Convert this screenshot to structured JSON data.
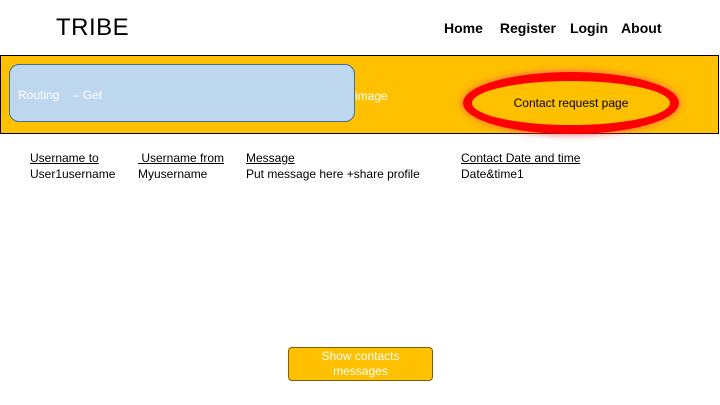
{
  "header": {
    "logo": "TRIBE",
    "nav": [
      "Home",
      "Register",
      "Login",
      "About"
    ]
  },
  "banner": {
    "routing_label": "Routing    – Get",
    "image_label": "image",
    "contact_label": "Contact request page"
  },
  "table": {
    "columns": [
      {
        "header": "Username to",
        "value": "User1username"
      },
      {
        "header": " Username from",
        "value": "Myusername"
      },
      {
        "header": "Message",
        "value": "Put message here +share profile"
      },
      {
        "header": "Contact Date and time",
        "value": "Date&time1"
      }
    ]
  },
  "footer": {
    "show_button": "Show contacts messages"
  },
  "colors": {
    "banner": "#ffc000",
    "routing_box": "#bdd7ee",
    "highlight_ring": "#ff0000"
  }
}
